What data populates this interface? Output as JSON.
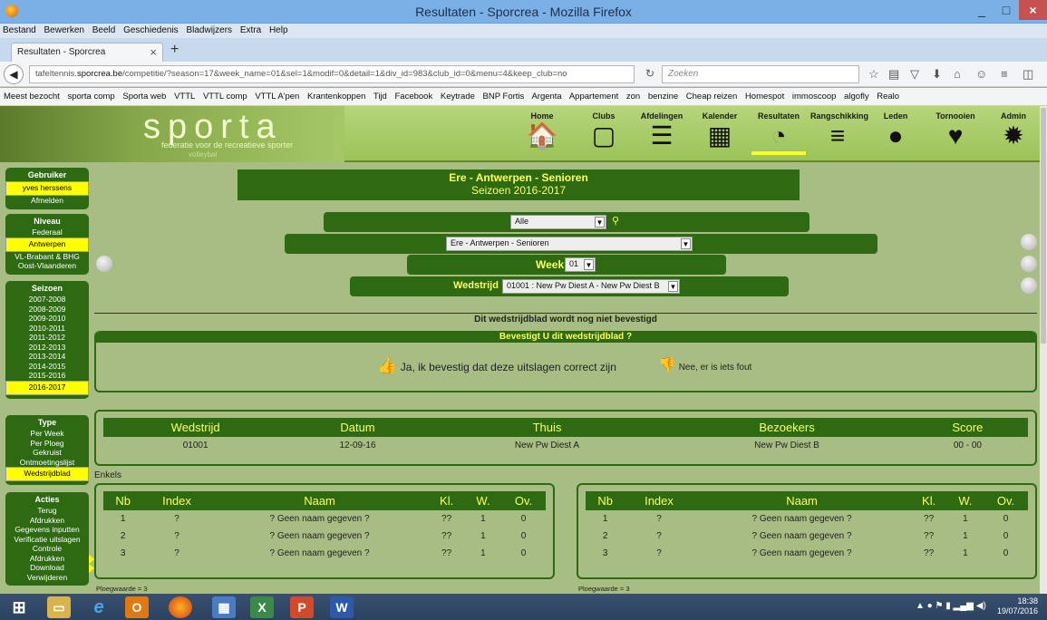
{
  "window": {
    "title": "Resultaten - Sporcrea - Mozilla Firefox",
    "min": "_",
    "max": "□",
    "close": "×"
  },
  "menu": [
    "Bestand",
    "Bewerken",
    "Beeld",
    "Geschiedenis",
    "Bladwijzers",
    "Extra",
    "Help"
  ],
  "tab": {
    "label": "Resultaten - Sporcrea",
    "close": "×",
    "new": "+"
  },
  "nav": {
    "url_prefix": "tafeltennis.",
    "url_domain": "sporcrea.be",
    "url_rest": "/competitie/?season=17&week_name=01&sel=1&modif=0&detail=1&div_id=983&club_id=0&menu=4&keep_club=no",
    "search_placeholder": "Zoeken"
  },
  "bookmarks": [
    "Meest bezocht",
    "sporta comp",
    "Sporta web",
    "VTTL",
    "VTTL comp",
    "VTTL A'pen",
    "Krantenkoppen",
    "Tijd",
    "Facebook",
    "Keytrade",
    "BNP Fortis",
    "Argenta",
    "Appartement",
    "zon",
    "benzine",
    "Cheap reizen",
    "Homespot",
    "immoscoop",
    "algofly",
    "Realo"
  ],
  "site": {
    "logo": "sporta",
    "logo_sub": "federatie voor de recreatieve sporter",
    "logo_sub2": "volleybal",
    "nav": [
      {
        "label": "Home",
        "icon": "home-icon",
        "glyph": "🏠"
      },
      {
        "label": "Clubs",
        "icon": "square-icon",
        "glyph": "▢"
      },
      {
        "label": "Afdelingen",
        "icon": "list-icon",
        "glyph": "☰"
      },
      {
        "label": "Kalender",
        "icon": "calendar-icon",
        "glyph": "▦"
      },
      {
        "label": "Resultaten",
        "icon": "gauge-icon",
        "glyph": "◔"
      },
      {
        "label": "Rangschikking",
        "icon": "ranking-icon",
        "glyph": "≡"
      },
      {
        "label": "Leden",
        "icon": "person-icon",
        "glyph": "●"
      },
      {
        "label": "Tornooien",
        "icon": "trophy-icon",
        "glyph": "♥"
      },
      {
        "label": "Admin",
        "icon": "gear-icon",
        "glyph": "✹"
      }
    ]
  },
  "sidebar": {
    "gebruiker": {
      "head": "Gebruiker",
      "items": [
        "yves herssens",
        "Afmelden"
      ]
    },
    "niveau": {
      "head": "Niveau",
      "items": [
        "Federaal",
        "Antwerpen",
        "VL-Brabant & BHG",
        "Oost-Vlaanderen"
      ]
    },
    "seizoen": {
      "head": "Seizoen",
      "items": [
        "2007-2008",
        "2008-2009",
        "2009-2010",
        "2010-2011",
        "2011-2012",
        "2012-2013",
        "2013-2014",
        "2014-2015",
        "2015-2016",
        "2016-2017"
      ]
    },
    "type": {
      "head": "Type",
      "items": [
        "Per Week",
        "Per Ploeg",
        "Gekruist",
        "Ontmoetingslijst",
        "Wedstrijdblad"
      ]
    },
    "acties": {
      "head": "Acties",
      "items": [
        "Terug",
        "Afdrukken",
        "Gegevens inputten",
        "Verificatie uitslagen",
        "Controle",
        "Afdrukken",
        "Download",
        "Verwijderen"
      ]
    }
  },
  "main": {
    "title": "Ere - Antwerpen - Senioren",
    "season": "Seizoen 2016-2017",
    "filter_all": "Alle",
    "division": "Ere - Antwerpen - Senioren",
    "week_label": "Week",
    "week_value": "01",
    "match_label": "Wedstrijd",
    "match_value": "01001 : New Pw Diest A - New Pw Diest B",
    "not_confirmed": "Dit wedstrijdblad wordt nog niet bevestigd",
    "confirm_q": "Bevestigt U dit wedstrijdblad ?",
    "yes": "Ja, ik bevestig dat deze uitslagen correct zijn",
    "no": "Nee, er is iets fout"
  },
  "match_table": {
    "headers": [
      "Wedstrijd",
      "Datum",
      "Thuis",
      "Bezoekers",
      "Score"
    ],
    "row": [
      "01001",
      "12-09-16",
      "New Pw Diest A",
      "New Pw Diest B",
      "00 - 00"
    ]
  },
  "enkels_label": "Enkels",
  "players_headers": [
    "Nb",
    "Index",
    "Naam",
    "Kl.",
    "W.",
    "Ov."
  ],
  "players": [
    [
      "1",
      "?",
      "? Geen naam gegeven ?",
      "??",
      "1",
      "0"
    ],
    [
      "2",
      "?",
      "? Geen naam gegeven ?",
      "??",
      "1",
      "0"
    ],
    [
      "3",
      "?",
      "? Geen naam gegeven ?",
      "??",
      "1",
      "0"
    ]
  ],
  "ploegwaarde": "Ploegwaarde = 3",
  "clock": {
    "time": "18:38",
    "date": "19/07/2016"
  }
}
